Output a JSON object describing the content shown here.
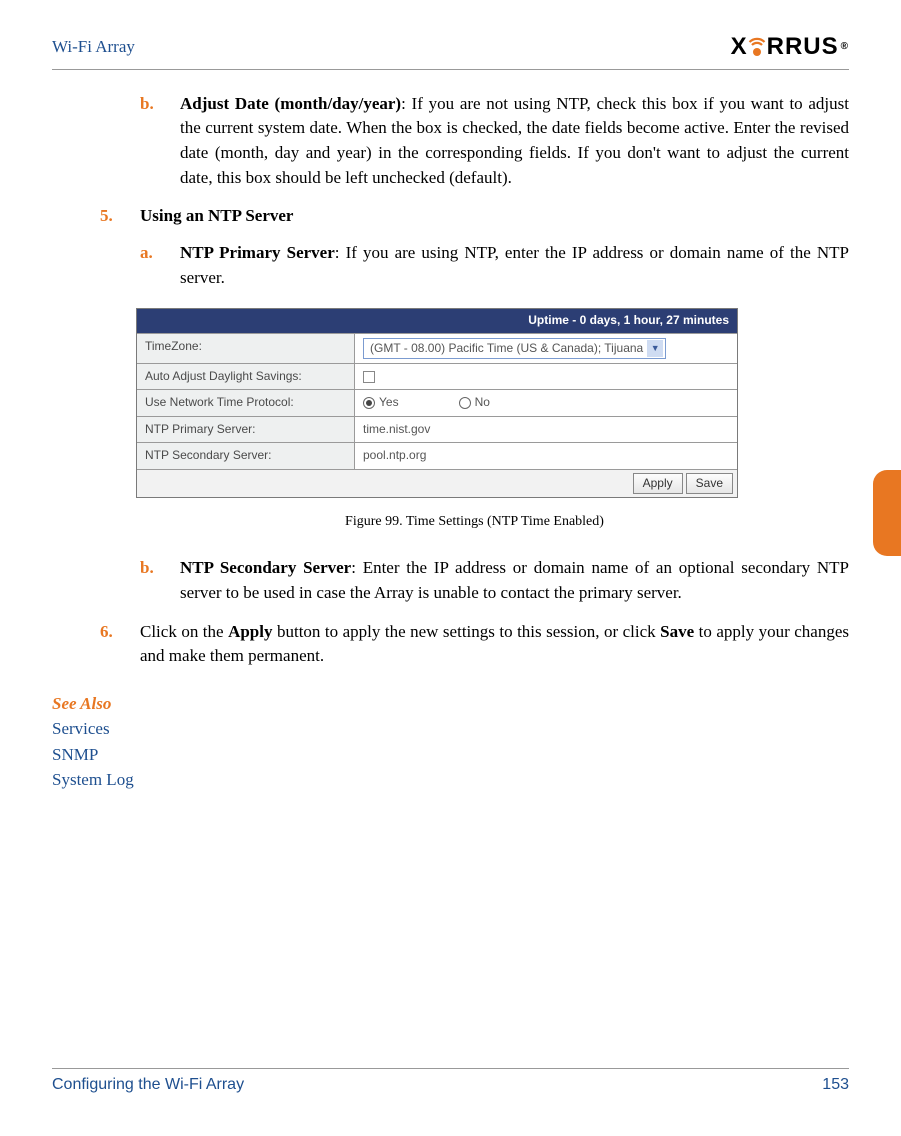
{
  "header": {
    "title": "Wi-Fi Array",
    "logo_text": "XIRRUS"
  },
  "items": {
    "b1_marker": "b.",
    "b1_bold": "Adjust Date (month/day/year)",
    "b1_text": ": If you are not using NTP, check this box if you want to adjust the current system date. When the box is checked, the date fields become active. Enter the revised date (month, day and year) in the corresponding fields. If you don't want to adjust the current date, this box should be left unchecked (default).",
    "s5_marker": "5.",
    "s5_text": "Using an NTP Server",
    "a_marker": "a.",
    "a_bold": "NTP Primary Server",
    "a_text": ": If you are using NTP, enter the IP address or domain name of the NTP server.",
    "b2_marker": "b.",
    "b2_bold": "NTP Secondary Server",
    "b2_text": ": Enter the IP address or domain name of an optional secondary NTP server to be used in case the Array is unable to contact the primary server.",
    "s6_marker": "6.",
    "s6_pre": "Click on the ",
    "s6_apply": "Apply",
    "s6_mid": " button to apply the new settings to this session, or click ",
    "s6_save": "Save",
    "s6_post": " to apply your changes and make them permanent."
  },
  "figure": {
    "uptime": "Uptime - 0 days, 1 hour, 27 minutes",
    "rows": {
      "tz_label": "TimeZone:",
      "tz_value": "(GMT - 08.00) Pacific Time (US & Canada); Tijuana",
      "dst_label": "Auto Adjust Daylight Savings:",
      "ntp_label": "Use Network Time Protocol:",
      "yes": "Yes",
      "no": "No",
      "primary_label": "NTP Primary Server:",
      "primary_value": "time.nist.gov",
      "secondary_label": "NTP Secondary Server:",
      "secondary_value": "pool.ntp.org"
    },
    "buttons": {
      "apply": "Apply",
      "save": "Save"
    },
    "caption": "Figure 99. Time Settings (NTP Time Enabled)"
  },
  "see_also": {
    "title": "See Also",
    "links": [
      "Services",
      "SNMP",
      "System Log"
    ]
  },
  "footer": {
    "section": "Configuring the Wi-Fi Array",
    "page": "153"
  }
}
